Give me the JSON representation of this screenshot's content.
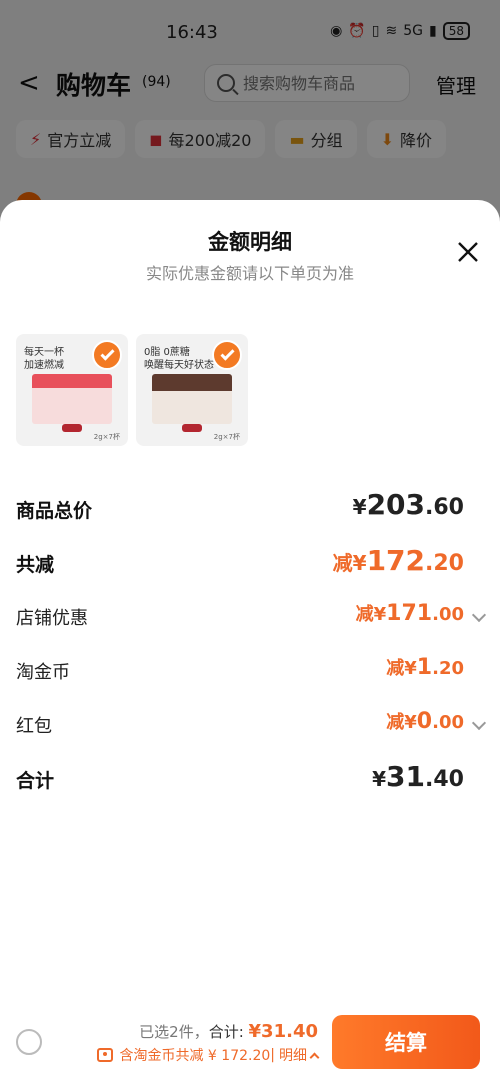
{
  "status_bar": {
    "time": "16:43",
    "battery": "58",
    "network": "5G"
  },
  "nav": {
    "title": "购物车",
    "count": "(94)",
    "search_placeholder": "搜索购物车商品",
    "manage_label": "管理"
  },
  "filters": [
    {
      "icon": "⚡",
      "label": "官方立减"
    },
    {
      "icon": "◼",
      "label": "每200减20"
    },
    {
      "icon": "▬",
      "label": "分组"
    },
    {
      "icon": "⬇",
      "label": "降价"
    }
  ],
  "sheet": {
    "title": "金额明细",
    "subtitle": "实际优惠金额请以下单页为准",
    "products": [
      {
        "text_line1": "每天一杯",
        "text_line2": "加速燃减",
        "note": "2g×7杯",
        "selected": true
      },
      {
        "text_line1": "0脂 0蔗糖",
        "text_line2": "唤醒每天好状态",
        "note": "2g×7杯",
        "selected": true
      }
    ],
    "rows": {
      "goods_total": {
        "label": "商品总价",
        "currency": "¥",
        "int": "203",
        "dec": ".60"
      },
      "total_discount": {
        "label": "共减",
        "prefix": "减¥",
        "int": "172",
        "dec": ".20"
      },
      "shop_discount": {
        "label": "店铺优惠",
        "prefix": "减¥",
        "int": "171",
        "dec": ".00"
      },
      "taojinbi": {
        "label": "淘金币",
        "prefix": "减¥",
        "int": "1",
        "dec": ".20"
      },
      "red_packet": {
        "label": "红包",
        "prefix": "减¥",
        "int": "0",
        "dec": ".00"
      },
      "sum": {
        "label": "合计",
        "currency": "¥",
        "int": "31",
        "dec": ".40"
      }
    }
  },
  "bottom_bar": {
    "selected_text": "已选2件，",
    "total_label": "合计: ",
    "total_value": "¥31.40",
    "discount_text": "含淘金币共减 ¥ 172.20",
    "separator": " | ",
    "detail_label": "明细",
    "checkout_label": "结算"
  },
  "colors": {
    "accent": "#ef6a2a",
    "checkout": "#f2591a"
  }
}
